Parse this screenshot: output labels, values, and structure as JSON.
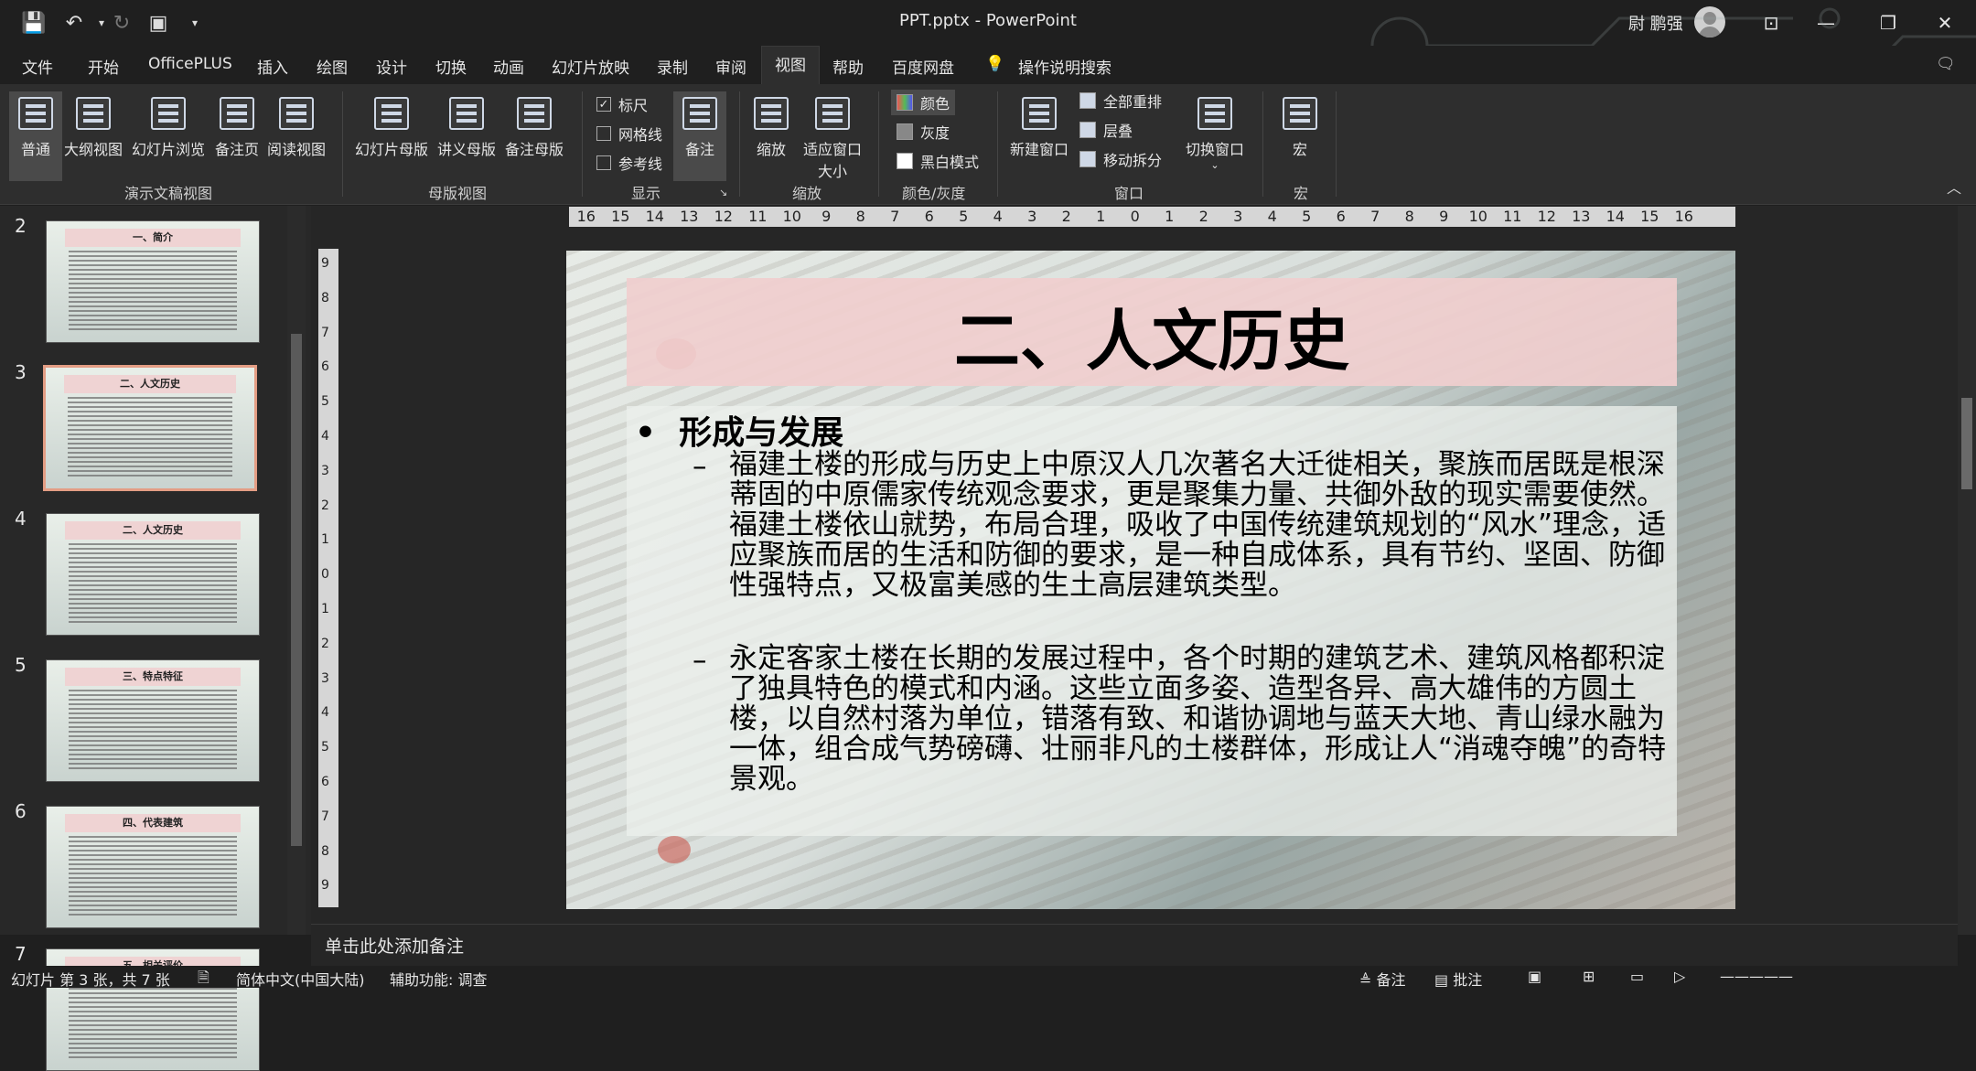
{
  "app": {
    "title": "PPT.pptx  -  PowerPoint",
    "user": "尉 鹏强"
  },
  "quick_access": [
    "save-icon",
    "undo-icon",
    "redo-icon",
    "slideshow-icon",
    "customize-icon"
  ],
  "menu": [
    "文件",
    "开始",
    "OfficePLUS",
    "插入",
    "绘图",
    "设计",
    "切换",
    "动画",
    "幻灯片放映",
    "录制",
    "审阅",
    "视图",
    "帮助",
    "百度网盘",
    "操作说明搜索"
  ],
  "active_tab": "视图",
  "ribbon": {
    "groups": [
      {
        "label": "演示文稿视图",
        "items": [
          "普通",
          "大纲视图",
          "幻灯片浏览",
          "备注页",
          "阅读视图"
        ]
      },
      {
        "label": "母版视图",
        "items": [
          "幻灯片母版",
          "讲义母版",
          "备注母版"
        ]
      },
      {
        "label": "显示",
        "checks": [
          {
            "label": "标尺",
            "checked": true
          },
          {
            "label": "网格线",
            "checked": false
          },
          {
            "label": "参考线",
            "checked": false
          }
        ],
        "notes": "备注"
      },
      {
        "label": "缩放",
        "items": [
          "缩放",
          "适应窗口大小"
        ]
      },
      {
        "label": "颜色/灰度",
        "items": [
          "颜色",
          "灰度",
          "黑白模式"
        ]
      },
      {
        "label": "窗口",
        "items": [
          "新建窗口",
          "全部重排",
          "层叠",
          "移动拆分",
          "切换窗口"
        ]
      },
      {
        "label": "宏",
        "items": [
          "宏"
        ]
      }
    ]
  },
  "thumbnails": [
    {
      "num": "2",
      "title": "一、简介"
    },
    {
      "num": "3",
      "title": "二、人文历史",
      "selected": true
    },
    {
      "num": "4",
      "title": "二、人文历史"
    },
    {
      "num": "5",
      "title": "三、特点特征"
    },
    {
      "num": "6",
      "title": "四、代表建筑"
    },
    {
      "num": "7",
      "title": "五、相关评价"
    }
  ],
  "ruler": {
    "h": [
      "16",
      "15",
      "14",
      "13",
      "12",
      "11",
      "10",
      "9",
      "8",
      "7",
      "6",
      "5",
      "4",
      "3",
      "2",
      "1",
      "0",
      "1",
      "2",
      "3",
      "4",
      "5",
      "6",
      "7",
      "8",
      "9",
      "10",
      "11",
      "12",
      "13",
      "14",
      "15",
      "16"
    ],
    "v": [
      "9",
      "8",
      "7",
      "6",
      "5",
      "4",
      "3",
      "2",
      "1",
      "0",
      "1",
      "2",
      "3",
      "4",
      "5",
      "6",
      "7",
      "8",
      "9"
    ]
  },
  "slide": {
    "title": "二、人文历史",
    "bullet": "形成与发展",
    "para1": "福建土楼的形成与历史上中原汉人几次著名大迁徙相关，聚族而居既是根深蒂固的中原儒家传统观念要求，更是聚集力量、共御外敌的现实需要使然。福建土楼依山就势，布局合理，吸收了中国传统建筑规划的“风水”理念，适应聚族而居的生活和防御的要求，是一种自成体系，具有节约、坚固、防御性强特点，又极富美感的生土高层建筑类型。",
    "para2": "永定客家土楼在长期的发展过程中，各个时期的建筑艺术、建筑风格都积淀了独具特色的模式和内涵。这些立面多姿、造型各异、高大雄伟的方圆土楼，以自然村落为单位，错落有致、和谐协调地与蓝天大地、青山绿水融为一体，组合成气势磅礴、壮丽非凡的土楼群体，形成让人“消魂夺魄”的奇特景观。"
  },
  "notes": "单击此处添加备注",
  "status": {
    "slide_info": "幻灯片 第 3 张，共 7 张",
    "language": "简体中文(中国大陆)",
    "accessibility": "辅助功能: 调查",
    "notes_btn": "备注",
    "comments_btn": "批注"
  }
}
